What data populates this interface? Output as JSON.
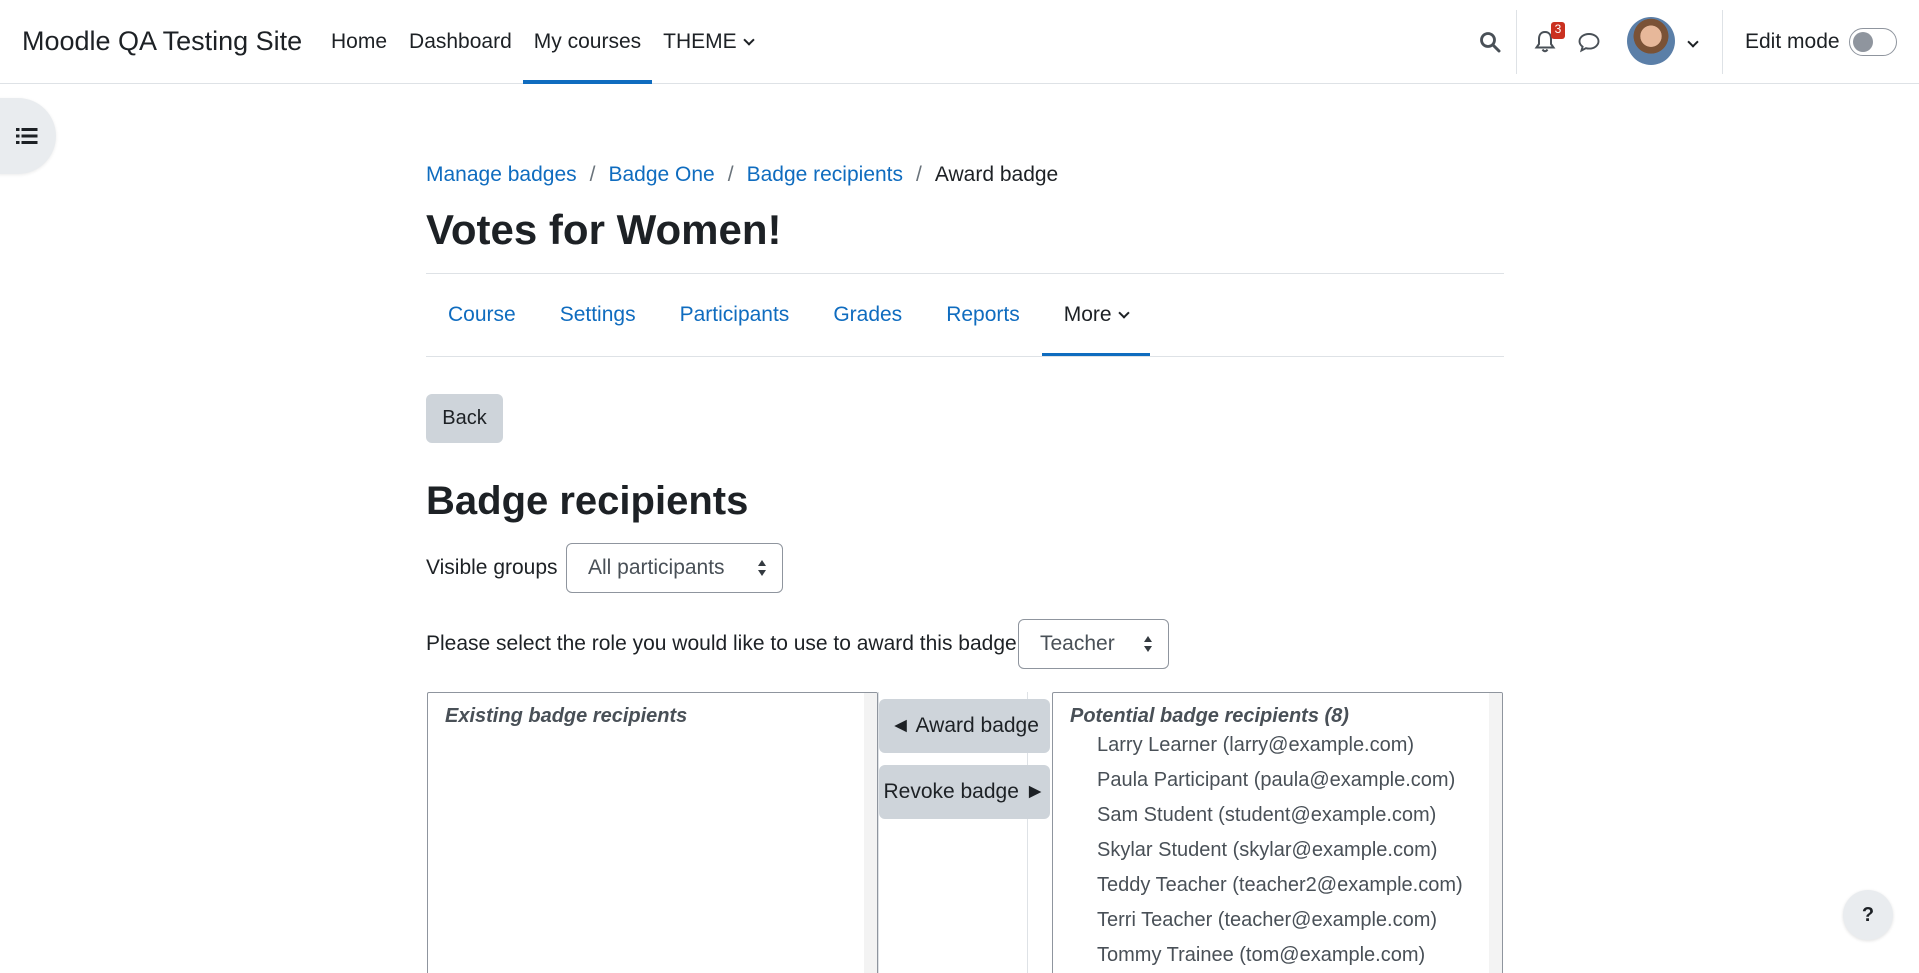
{
  "navbar": {
    "site_name": "Moodle QA Testing Site",
    "items": [
      {
        "label": "Home",
        "active": false
      },
      {
        "label": "Dashboard",
        "active": false
      },
      {
        "label": "My courses",
        "active": true
      },
      {
        "label": "THEME",
        "active": false,
        "has_dropdown": true
      }
    ],
    "notification_count": "3",
    "edit_mode_label": "Edit mode",
    "edit_mode_on": false
  },
  "breadcrumb": [
    {
      "label": "Manage badges",
      "link": true
    },
    {
      "label": "Badge One",
      "link": true
    },
    {
      "label": "Badge recipients",
      "link": true
    },
    {
      "label": "Award badge",
      "link": false
    }
  ],
  "page_title": "Votes for Women!",
  "secondary_nav": [
    {
      "label": "Course"
    },
    {
      "label": "Settings"
    },
    {
      "label": "Participants"
    },
    {
      "label": "Grades"
    },
    {
      "label": "Reports"
    },
    {
      "label": "More",
      "active": true,
      "has_dropdown": true
    }
  ],
  "back_label": "Back",
  "section_title": "Badge recipients",
  "visible_groups": {
    "label": "Visible groups",
    "value": "All participants"
  },
  "role_select": {
    "label": "Please select the role you would like to use to award this badge:",
    "value": "Teacher"
  },
  "existing": {
    "label": "Existing badge recipients"
  },
  "award_label": "◄ Award badge",
  "revoke_label": "Revoke badge ►",
  "potential": {
    "label": "Potential badge recipients (8)",
    "options": [
      "Larry Learner (larry@example.com)",
      "Paula Participant (paula@example.com)",
      "Sam Student (student@example.com)",
      "Skylar Student (skylar@example.com)",
      "Teddy Teacher (teacher2@example.com)",
      "Terri Teacher (teacher@example.com)",
      "Tommy Trainee (tom@example.com)"
    ]
  },
  "help_label": "?",
  "colors": {
    "link": "#0f6cbf",
    "text": "#1d2125",
    "button_secondary": "#ced4da",
    "badge": "#ca3120"
  }
}
